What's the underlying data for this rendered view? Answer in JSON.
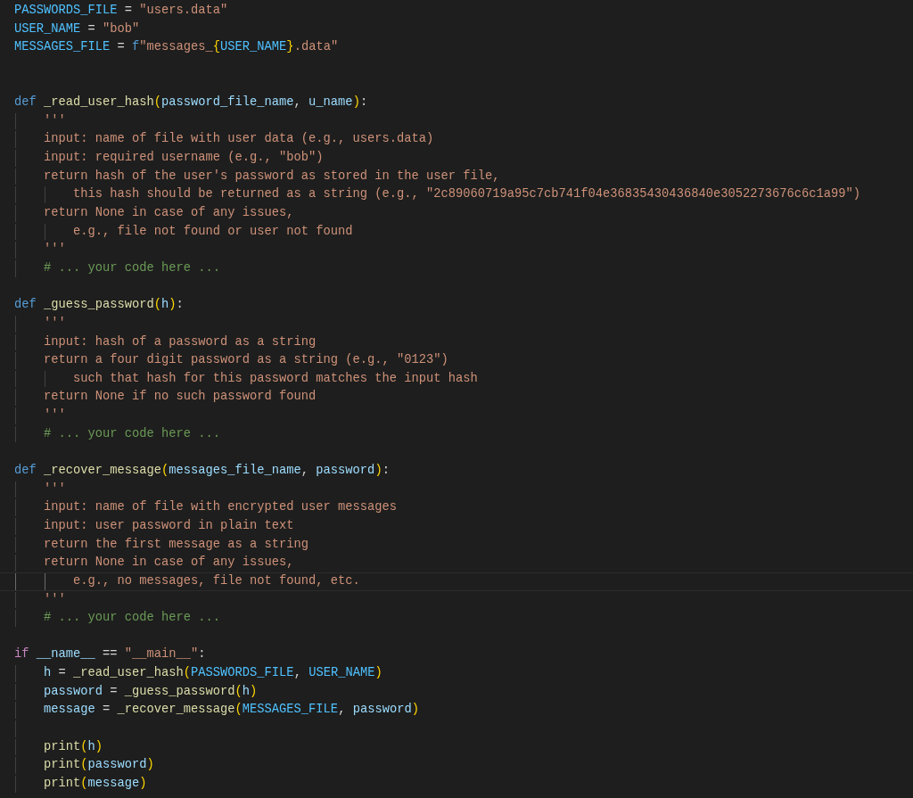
{
  "editor": {
    "lines": [
      {
        "current": false,
        "tokens": [
          {
            "text": "PASSWORDS_FILE",
            "kind": "const"
          },
          {
            "text": " = ",
            "kind": "plain"
          },
          {
            "text": "\"users.data\"",
            "kind": "string"
          }
        ]
      },
      {
        "current": false,
        "tokens": [
          {
            "text": "USER_NAME",
            "kind": "const"
          },
          {
            "text": " = ",
            "kind": "plain"
          },
          {
            "text": "\"bob\"",
            "kind": "string"
          }
        ]
      },
      {
        "current": false,
        "tokens": [
          {
            "text": "MESSAGES_FILE",
            "kind": "const"
          },
          {
            "text": " = ",
            "kind": "plain"
          },
          {
            "text": "f",
            "kind": "keyword"
          },
          {
            "text": "\"messages_",
            "kind": "string"
          },
          {
            "text": "{",
            "kind": "bracket"
          },
          {
            "text": "USER_NAME",
            "kind": "const"
          },
          {
            "text": "}",
            "kind": "bracket"
          },
          {
            "text": ".data\"",
            "kind": "string"
          }
        ]
      },
      {
        "current": false
      },
      {
        "current": false
      },
      {
        "current": false,
        "tokens": [
          {
            "text": "def ",
            "kind": "keyword"
          },
          {
            "text": "_read_user_hash",
            "kind": "function"
          },
          {
            "text": "(",
            "kind": "bracket"
          },
          {
            "text": "password_file_name",
            "kind": "variable"
          },
          {
            "text": ", ",
            "kind": "plain"
          },
          {
            "text": "u_name",
            "kind": "variable"
          },
          {
            "text": ")",
            "kind": "bracket"
          },
          {
            "text": ":",
            "kind": "plain"
          }
        ]
      },
      {
        "current": false,
        "tokens": [
          {
            "text": "    '''",
            "kind": "string"
          }
        ]
      },
      {
        "current": false,
        "tokens": [
          {
            "text": "    input: name of file with user data (e.g., users.data)",
            "kind": "string"
          }
        ]
      },
      {
        "current": false,
        "tokens": [
          {
            "text": "    input: required username (e.g., \"bob\")",
            "kind": "string"
          }
        ]
      },
      {
        "current": false,
        "tokens": [
          {
            "text": "    return hash of the user's password as stored in the user file,",
            "kind": "string"
          }
        ]
      },
      {
        "current": false,
        "tokens": [
          {
            "text": "        this hash should be returned as a string (e.g., \"2c89060719a95c7cb741f04e36835430436840e3052273676c6c1a99\")",
            "kind": "string"
          }
        ]
      },
      {
        "current": false,
        "tokens": [
          {
            "text": "    return None in case of any issues,",
            "kind": "string"
          }
        ]
      },
      {
        "current": false,
        "tokens": [
          {
            "text": "        e.g., file not found or user not found",
            "kind": "string"
          }
        ]
      },
      {
        "current": false,
        "tokens": [
          {
            "text": "    '''",
            "kind": "string"
          }
        ]
      },
      {
        "current": false,
        "tokens": [
          {
            "text": "    # ... your code here ...",
            "kind": "comment"
          }
        ]
      },
      {
        "current": false
      },
      {
        "current": false,
        "tokens": [
          {
            "text": "def ",
            "kind": "keyword"
          },
          {
            "text": "_guess_password",
            "kind": "function"
          },
          {
            "text": "(",
            "kind": "bracket"
          },
          {
            "text": "h",
            "kind": "variable"
          },
          {
            "text": ")",
            "kind": "bracket"
          },
          {
            "text": ":",
            "kind": "plain"
          }
        ]
      },
      {
        "current": false,
        "tokens": [
          {
            "text": "    '''",
            "kind": "string"
          }
        ]
      },
      {
        "current": false,
        "tokens": [
          {
            "text": "    input: hash of a password as a string",
            "kind": "string"
          }
        ]
      },
      {
        "current": false,
        "tokens": [
          {
            "text": "    return a four digit password as a string (e.g., \"0123\")",
            "kind": "string"
          }
        ]
      },
      {
        "current": false,
        "tokens": [
          {
            "text": "        such that hash for this password matches the input hash",
            "kind": "string"
          }
        ]
      },
      {
        "current": false,
        "tokens": [
          {
            "text": "    return None if no such password found",
            "kind": "string"
          }
        ]
      },
      {
        "current": false,
        "tokens": [
          {
            "text": "    '''",
            "kind": "string"
          }
        ]
      },
      {
        "current": false,
        "tokens": [
          {
            "text": "    # ... your code here ...",
            "kind": "comment"
          }
        ]
      },
      {
        "current": false
      },
      {
        "current": false,
        "tokens": [
          {
            "text": "def ",
            "kind": "keyword"
          },
          {
            "text": "_recover_message",
            "kind": "function"
          },
          {
            "text": "(",
            "kind": "bracket"
          },
          {
            "text": "messages_file_name",
            "kind": "variable"
          },
          {
            "text": ", ",
            "kind": "plain"
          },
          {
            "text": "password",
            "kind": "variable"
          },
          {
            "text": ")",
            "kind": "bracket"
          },
          {
            "text": ":",
            "kind": "plain"
          }
        ]
      },
      {
        "current": false,
        "tokens": [
          {
            "text": "    '''",
            "kind": "string"
          }
        ]
      },
      {
        "current": false,
        "tokens": [
          {
            "text": "    input: name of file with encrypted user messages",
            "kind": "string"
          }
        ]
      },
      {
        "current": false,
        "tokens": [
          {
            "text": "    input: user password in plain text",
            "kind": "string"
          }
        ]
      },
      {
        "current": false,
        "tokens": [
          {
            "text": "    return the first message as a string",
            "kind": "string"
          }
        ]
      },
      {
        "current": false,
        "tokens": [
          {
            "text": "    return None in case of any issues,",
            "kind": "string"
          }
        ]
      },
      {
        "current": true,
        "tokens": [
          {
            "text": "        e.g., no messages, file not found, etc.",
            "kind": "string"
          }
        ]
      },
      {
        "current": false,
        "tokens": [
          {
            "text": "    '''",
            "kind": "string"
          }
        ]
      },
      {
        "current": false,
        "tokens": [
          {
            "text": "    # ... your code here ...",
            "kind": "comment"
          }
        ]
      },
      {
        "current": false
      },
      {
        "current": false,
        "tokens": [
          {
            "text": "if ",
            "kind": "control"
          },
          {
            "text": "__name__",
            "kind": "variable"
          },
          {
            "text": " == ",
            "kind": "plain"
          },
          {
            "text": "\"__main__\"",
            "kind": "string"
          },
          {
            "text": ":",
            "kind": "plain"
          }
        ]
      },
      {
        "current": false,
        "tokens": [
          {
            "text": "    h",
            "kind": "variable"
          },
          {
            "text": " = ",
            "kind": "plain"
          },
          {
            "text": "_read_user_hash",
            "kind": "function"
          },
          {
            "text": "(",
            "kind": "bracket"
          },
          {
            "text": "PASSWORDS_FILE",
            "kind": "const"
          },
          {
            "text": ", ",
            "kind": "plain"
          },
          {
            "text": "USER_NAME",
            "kind": "const"
          },
          {
            "text": ")",
            "kind": "bracket"
          }
        ]
      },
      {
        "current": false,
        "tokens": [
          {
            "text": "    password",
            "kind": "variable"
          },
          {
            "text": " = ",
            "kind": "plain"
          },
          {
            "text": "_guess_password",
            "kind": "function"
          },
          {
            "text": "(",
            "kind": "bracket"
          },
          {
            "text": "h",
            "kind": "variable"
          },
          {
            "text": ")",
            "kind": "bracket"
          }
        ]
      },
      {
        "current": false,
        "tokens": [
          {
            "text": "    message",
            "kind": "variable"
          },
          {
            "text": " = ",
            "kind": "plain"
          },
          {
            "text": "_recover_message",
            "kind": "function"
          },
          {
            "text": "(",
            "kind": "bracket"
          },
          {
            "text": "MESSAGES_FILE",
            "kind": "const"
          },
          {
            "text": ", ",
            "kind": "plain"
          },
          {
            "text": "password",
            "kind": "variable"
          },
          {
            "text": ")",
            "kind": "bracket"
          }
        ]
      },
      {
        "current": false
      },
      {
        "current": false,
        "tokens": [
          {
            "text": "    print",
            "kind": "function"
          },
          {
            "text": "(",
            "kind": "bracket"
          },
          {
            "text": "h",
            "kind": "variable"
          },
          {
            "text": ")",
            "kind": "bracket"
          }
        ]
      },
      {
        "current": false,
        "tokens": [
          {
            "text": "    print",
            "kind": "function"
          },
          {
            "text": "(",
            "kind": "bracket"
          },
          {
            "text": "password",
            "kind": "variable"
          },
          {
            "text": ")",
            "kind": "bracket"
          }
        ]
      },
      {
        "current": false,
        "tokens": [
          {
            "text": "    print",
            "kind": "function"
          },
          {
            "text": "(",
            "kind": "bracket"
          },
          {
            "text": "message",
            "kind": "variable"
          },
          {
            "text": ")",
            "kind": "bracket"
          }
        ]
      }
    ]
  }
}
